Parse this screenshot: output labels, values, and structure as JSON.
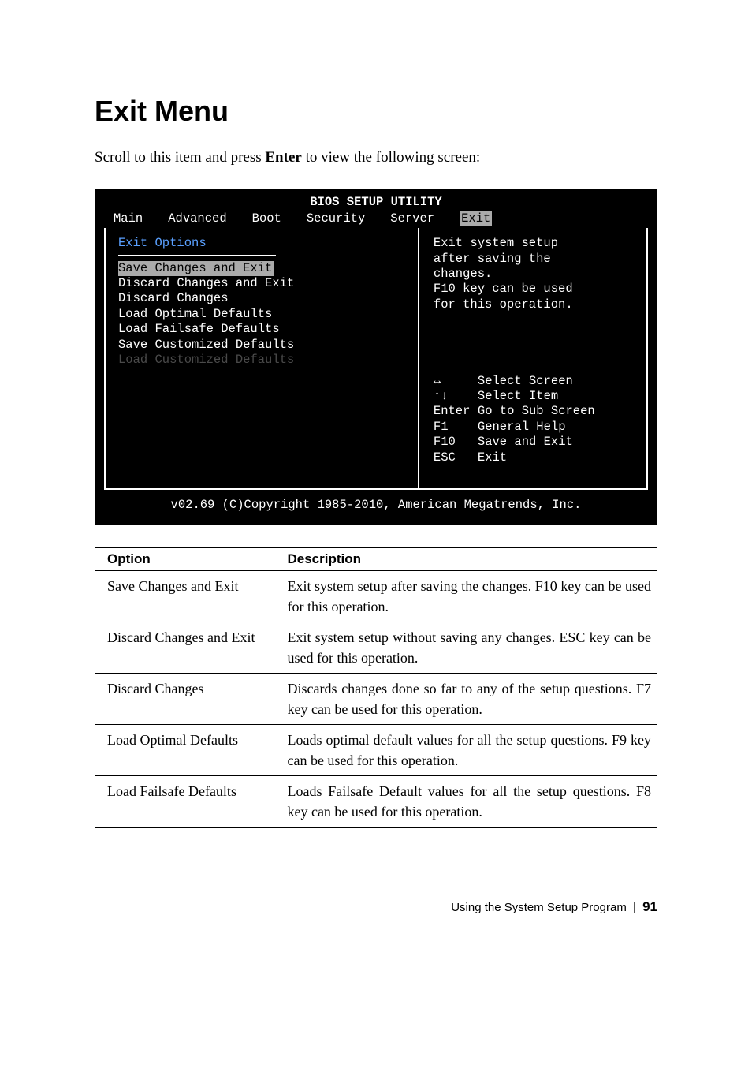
{
  "heading": "Exit Menu",
  "intro_pre": "Scroll to this item and press ",
  "intro_key": "Enter",
  "intro_post": " to view the following screen:",
  "bios": {
    "title": "BIOS SETUP UTILITY",
    "tabs": [
      "Main",
      "Advanced",
      "Boot",
      "Security",
      "Server",
      "Exit"
    ],
    "active_tab_index": 5,
    "left": {
      "heading": "Exit Options",
      "items": [
        {
          "label": "Save Changes and Exit",
          "selected": true,
          "disabled": false
        },
        {
          "label": "Discard Changes and Exit",
          "selected": false,
          "disabled": false
        },
        {
          "label": "Discard Changes",
          "selected": false,
          "disabled": false
        },
        {
          "label": "",
          "selected": false,
          "disabled": false
        },
        {
          "label": "Load Optimal Defaults",
          "selected": false,
          "disabled": false
        },
        {
          "label": "Load Failsafe Defaults",
          "selected": false,
          "disabled": false
        },
        {
          "label": "",
          "selected": false,
          "disabled": false
        },
        {
          "label": "Save Customized Defaults",
          "selected": false,
          "disabled": false
        },
        {
          "label": "Load Customized Defaults",
          "selected": false,
          "disabled": true
        }
      ]
    },
    "right": {
      "help_lines": [
        "Exit system setup",
        "after saving the",
        "changes.",
        "",
        "F10 key can be used",
        "for this operation."
      ],
      "nav": [
        {
          "key": "↔",
          "label": "Select Screen"
        },
        {
          "key": "↑↓",
          "label": "Select Item"
        },
        {
          "key": "Enter",
          "label": "Go to Sub Screen"
        },
        {
          "key": "F1",
          "label": "General Help"
        },
        {
          "key": "F10",
          "label": "Save and Exit"
        },
        {
          "key": "ESC",
          "label": "Exit"
        }
      ]
    },
    "footer": "v02.69 (C)Copyright 1985-2010, American Megatrends, Inc."
  },
  "table": {
    "headers": [
      "Option",
      "Description"
    ],
    "rows": [
      {
        "option": "Save Changes and Exit",
        "desc": "Exit system setup after saving the changes. F10 key can be used for this operation."
      },
      {
        "option": "Discard Changes and Exit",
        "desc": "Exit system setup without saving any changes. ESC key can be used for this operation."
      },
      {
        "option": "Discard Changes",
        "desc": "Discards changes done so far to any of the setup questions. F7 key can be used for this operation."
      },
      {
        "option": "Load Optimal Defaults",
        "desc": "Loads optimal default values for all the setup questions. F9 key can be used for this operation."
      },
      {
        "option": "Load Failsafe Defaults",
        "desc": "Loads Failsafe Default values for all the setup questions. F8 key can be used for this operation."
      }
    ]
  },
  "footer": {
    "text": "Using the System Setup Program",
    "page": "91"
  }
}
